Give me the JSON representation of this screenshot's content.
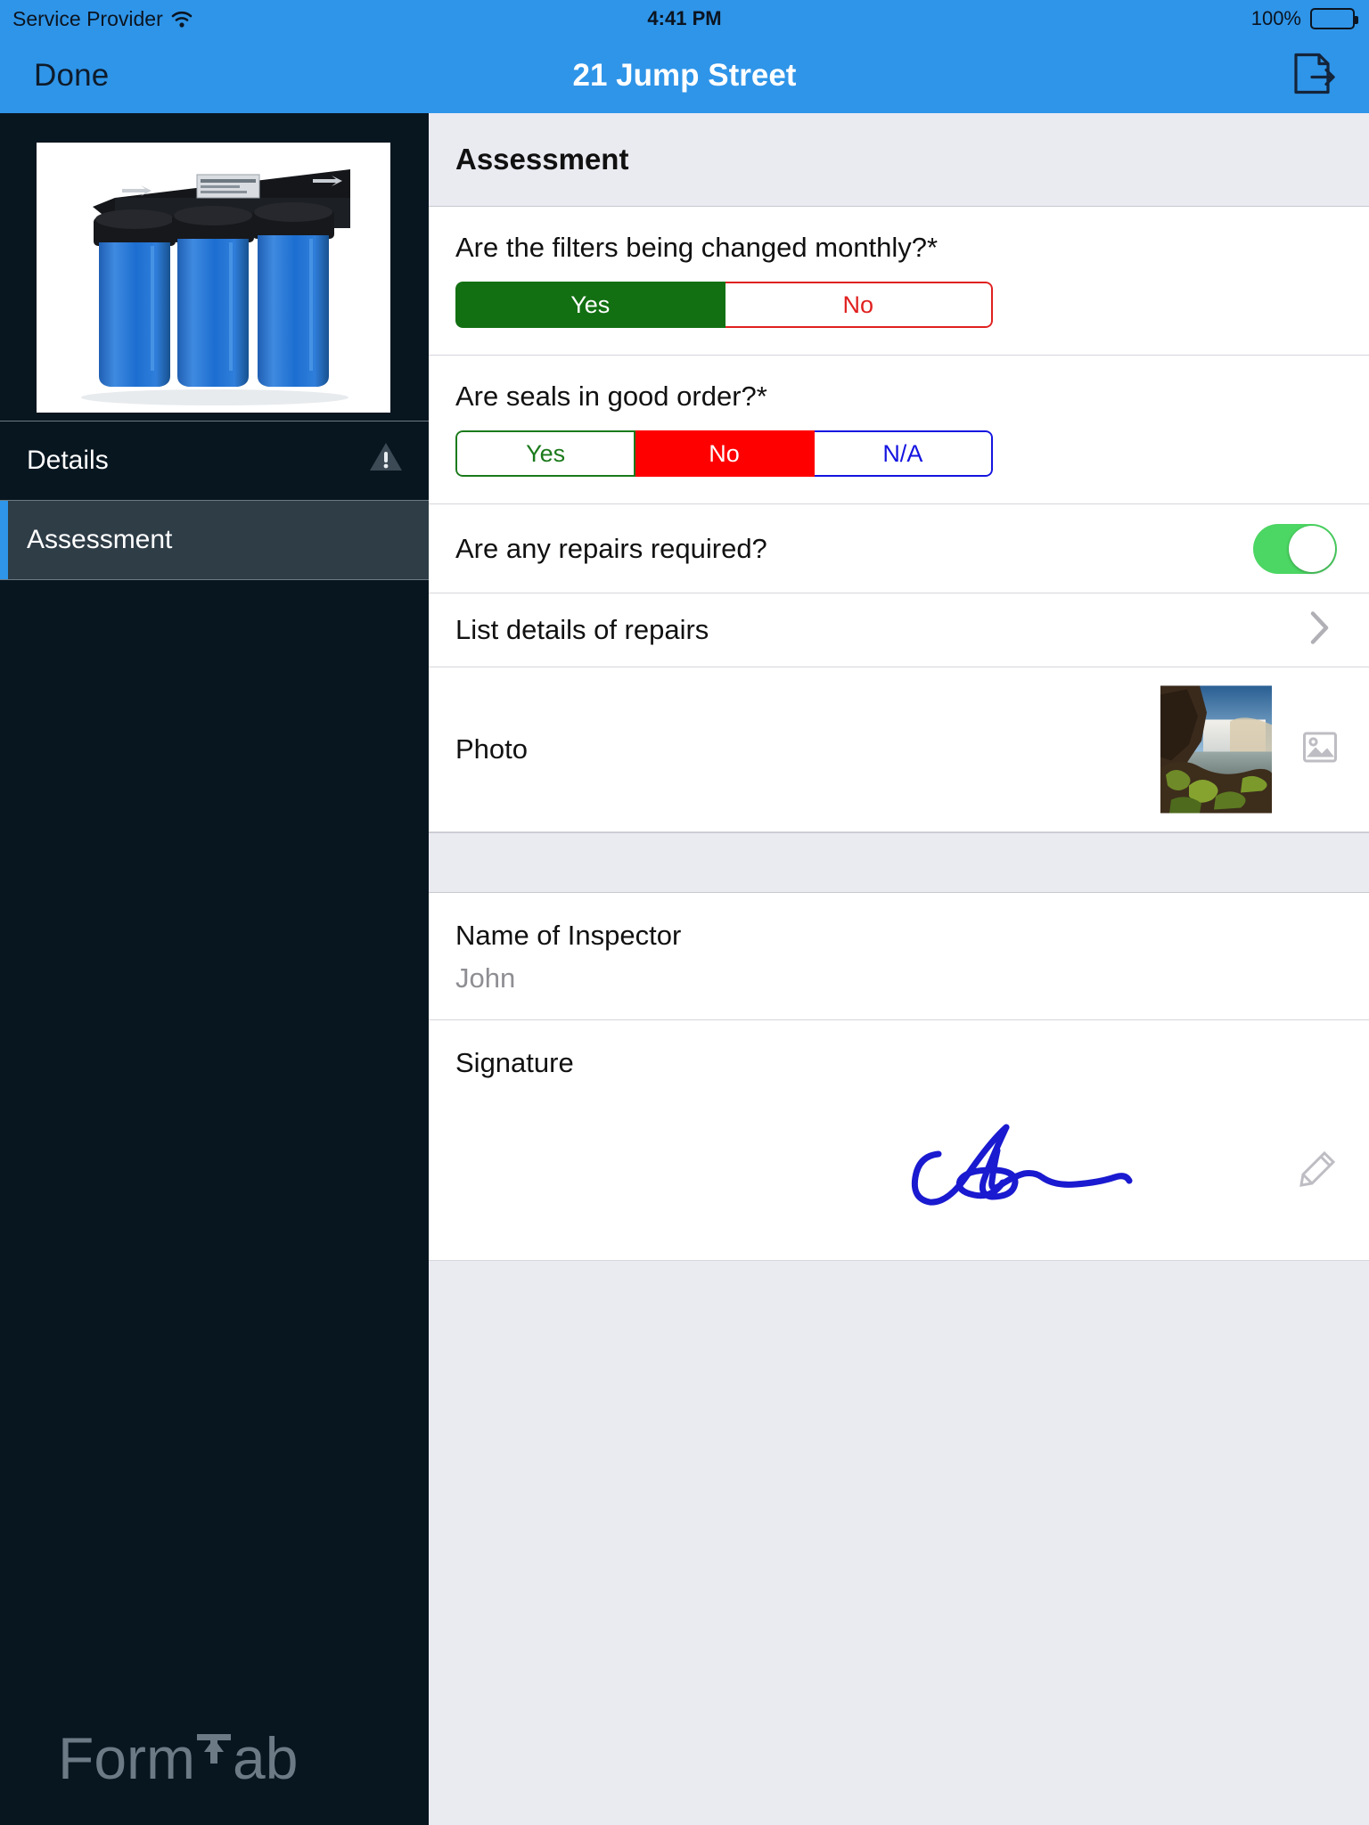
{
  "status_bar": {
    "carrier": "Service Provider",
    "wifi_icon": "wifi-icon",
    "time": "4:41 PM",
    "battery_percent": "100%",
    "battery_icon": "battery-full-icon"
  },
  "nav_bar": {
    "done_label": "Done",
    "title": "21 Jump Street",
    "export_icon": "document-export-icon"
  },
  "sidebar": {
    "thumbnail_icon": "water-filter-housing-image",
    "items": [
      {
        "label": "Details",
        "selected": false,
        "status_icon": "warning-triangle-icon"
      },
      {
        "label": "Assessment",
        "selected": true,
        "status_icon": ""
      }
    ],
    "logo_text_before": "Form",
    "logo_text_after": "ab",
    "logo_arrow_icon": "up-arrow-t-icon"
  },
  "content": {
    "section_title": "Assessment",
    "questions": [
      {
        "label": "Are the filters being changed monthly?*",
        "type": "segmented",
        "options": [
          {
            "label": "Yes",
            "selected": true,
            "color": "#127012"
          },
          {
            "label": "No",
            "selected": false,
            "color": "#e02020"
          }
        ]
      },
      {
        "label": "Are seals in good order?*",
        "type": "segmented",
        "options": [
          {
            "label": "Yes",
            "selected": false,
            "color": "#1b7a1b"
          },
          {
            "label": "No",
            "selected": true,
            "color": "#ff0000"
          },
          {
            "label": "N/A",
            "selected": false,
            "color": "#1414e0"
          }
        ]
      }
    ],
    "toggle_row": {
      "label": "Are any repairs required?",
      "value": "on",
      "on_color": "#4cd663"
    },
    "link_row": {
      "label": "List details of repairs",
      "chevron_icon": "chevron-right-icon"
    },
    "photo_row": {
      "label": "Photo",
      "thumbnail_icon": "waterfall-photo-thumbnail",
      "action_icon": "image-picker-icon"
    },
    "inspector_field": {
      "label": "Name of Inspector",
      "value": "John"
    },
    "signature_field": {
      "label": "Signature",
      "signature_icon": "handwritten-signature",
      "edit_icon": "pencil-edit-icon",
      "ink_color": "#1a1ad0"
    }
  }
}
